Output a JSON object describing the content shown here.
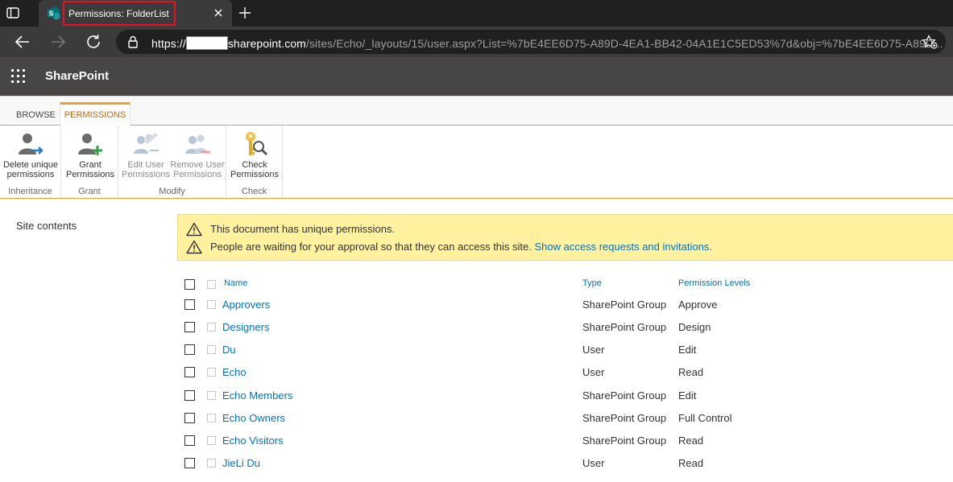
{
  "browser": {
    "tab_title": "Permissions: FolderList",
    "url_scheme": "https://",
    "url_domain": "sharepoint.com",
    "url_path": "/sites/Echo/_layouts/15/user.aspx?List=%7bE4EE6D75-A89D-4EA1-BB42-04A1E1C5ED53%7d&obj=%7bE4EE6D75-A89D..."
  },
  "suite": {
    "brand": "SharePoint"
  },
  "ribbon": {
    "tabs": {
      "browse": "BROWSE",
      "permissions": "PERMISSIONS"
    },
    "groups": [
      {
        "label": "Inheritance",
        "buttons": [
          {
            "line1": "Delete unique",
            "line2": "permissions"
          }
        ]
      },
      {
        "label": "Grant",
        "buttons": [
          {
            "line1": "Grant",
            "line2": "Permissions"
          }
        ]
      },
      {
        "label": "Modify",
        "buttons": [
          {
            "line1": "Edit User",
            "line2": "Permissions"
          },
          {
            "line1": "Remove User",
            "line2": "Permissions"
          }
        ]
      },
      {
        "label": "Check",
        "buttons": [
          {
            "line1": "Check",
            "line2": "Permissions"
          }
        ]
      }
    ]
  },
  "leftnav": {
    "site_contents": "Site contents"
  },
  "status": {
    "line1": "This document has unique permissions.",
    "line2": "People are waiting for your approval so that they can access this site.",
    "line2_link": "Show access requests and invitations."
  },
  "table": {
    "columns": {
      "name": "Name",
      "type": "Type",
      "level": "Permission Levels"
    },
    "rows": [
      {
        "name": "Approvers",
        "type": "SharePoint Group",
        "level": "Approve"
      },
      {
        "name": "Designers",
        "type": "SharePoint Group",
        "level": "Design"
      },
      {
        "name": "Du",
        "type": "User",
        "level": "Edit"
      },
      {
        "name": "Echo",
        "type": "User",
        "level": "Read"
      },
      {
        "name": "Echo Members",
        "type": "SharePoint Group",
        "level": "Edit"
      },
      {
        "name": "Echo Owners",
        "type": "SharePoint Group",
        "level": "Full Control"
      },
      {
        "name": "Echo Visitors",
        "type": "SharePoint Group",
        "level": "Read"
      },
      {
        "name": "JieLi Du",
        "type": "User",
        "level": "Read"
      }
    ]
  },
  "colors": {
    "accent_orange": "#f0a030",
    "link_blue": "#0072c6",
    "status_yellow": "#fff19d",
    "suite_bar": "#484644",
    "sharepoint_teal": "#038387"
  }
}
